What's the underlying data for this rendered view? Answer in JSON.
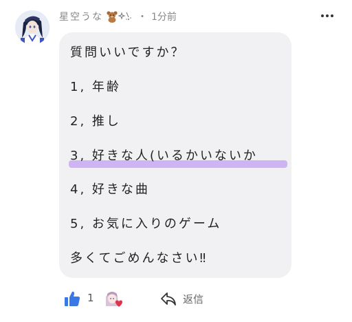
{
  "comment": {
    "username": "星空うな",
    "decoration_icons": [
      "teddy-bear-icon",
      "sparkle-icon"
    ],
    "separator": "・",
    "timestamp": "1分前",
    "lines": [
      "質問いいですか？",
      "1, 年齢",
      "2, 推し",
      "3, 好きな人(いるかいないか",
      "4, 好きな曲",
      "5, お気に入りのゲーム",
      "多くてごめんなさい‼︎"
    ],
    "highlighted_line_index": 3,
    "highlight_color": "#c9a9f3"
  },
  "actions": {
    "like_count": "1",
    "reply_label": "返信",
    "like_color": "#3b78e7"
  }
}
